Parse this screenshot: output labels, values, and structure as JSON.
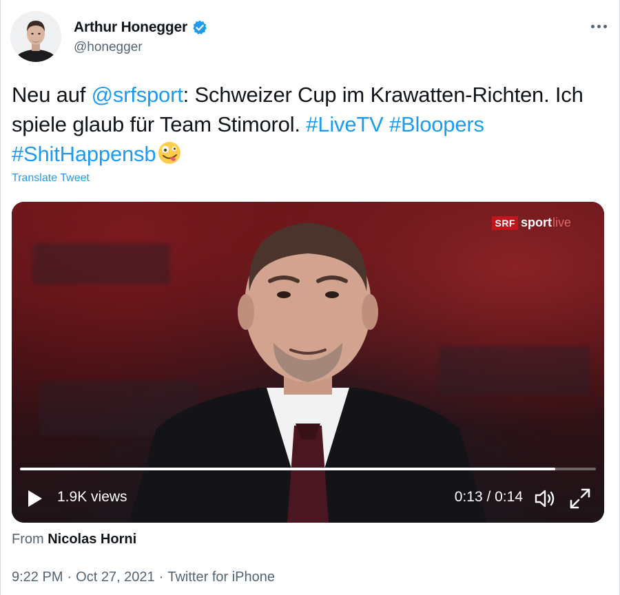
{
  "author": {
    "display_name": "Arthur Honegger",
    "handle": "@honegger",
    "verified": true,
    "verified_color": "#1d9bf0",
    "avatar_icon": "avatar-photo"
  },
  "menu": {
    "more_icon": "more-horizontal-icon"
  },
  "tweet": {
    "segments": [
      {
        "text": "Neu auf ",
        "type": "text"
      },
      {
        "text": "@srfsport",
        "type": "link"
      },
      {
        "text": ": Schweizer Cup im Krawatten-Richten. Ich spiele glaub für Team Stimorol. ",
        "type": "text"
      },
      {
        "text": "#LiveTV",
        "type": "link"
      },
      {
        "text": " ",
        "type": "text"
      },
      {
        "text": "#Bloopers",
        "type": "link"
      },
      {
        "text": " ",
        "type": "text"
      },
      {
        "text": "#ShitHappensb",
        "type": "link"
      }
    ],
    "emoji": "zany-face-emoji",
    "translate_label": "Translate Tweet",
    "link_color": "#1d9bf0"
  },
  "video": {
    "brand_srf": "SRF",
    "brand_sport": "sport",
    "brand_live": "live",
    "views": "1.9K views",
    "time": "0:13 / 0:14",
    "progress": 0.93,
    "brand_color": "#c3161c"
  },
  "source": {
    "prefix": "From ",
    "name": "Nicolas Horni"
  },
  "meta": {
    "time": "9:22 PM",
    "sep1": "·",
    "date": "Oct 27, 2021",
    "sep2": "·",
    "client": "Twitter for iPhone"
  }
}
